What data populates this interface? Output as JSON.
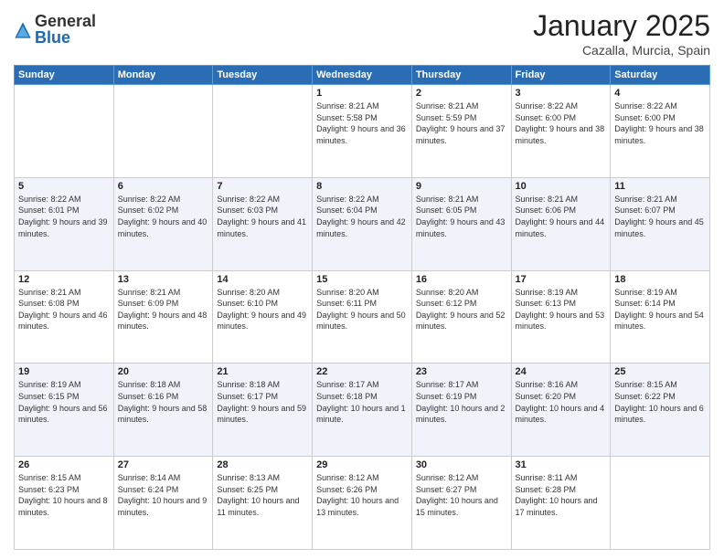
{
  "logo": {
    "general": "General",
    "blue": "Blue"
  },
  "title": {
    "month": "January 2025",
    "location": "Cazalla, Murcia, Spain"
  },
  "headers": [
    "Sunday",
    "Monday",
    "Tuesday",
    "Wednesday",
    "Thursday",
    "Friday",
    "Saturday"
  ],
  "weeks": [
    [
      {
        "day": "",
        "info": ""
      },
      {
        "day": "",
        "info": ""
      },
      {
        "day": "",
        "info": ""
      },
      {
        "day": "1",
        "info": "Sunrise: 8:21 AM\nSunset: 5:58 PM\nDaylight: 9 hours and 36 minutes."
      },
      {
        "day": "2",
        "info": "Sunrise: 8:21 AM\nSunset: 5:59 PM\nDaylight: 9 hours and 37 minutes."
      },
      {
        "day": "3",
        "info": "Sunrise: 8:22 AM\nSunset: 6:00 PM\nDaylight: 9 hours and 38 minutes."
      },
      {
        "day": "4",
        "info": "Sunrise: 8:22 AM\nSunset: 6:00 PM\nDaylight: 9 hours and 38 minutes."
      }
    ],
    [
      {
        "day": "5",
        "info": "Sunrise: 8:22 AM\nSunset: 6:01 PM\nDaylight: 9 hours and 39 minutes."
      },
      {
        "day": "6",
        "info": "Sunrise: 8:22 AM\nSunset: 6:02 PM\nDaylight: 9 hours and 40 minutes."
      },
      {
        "day": "7",
        "info": "Sunrise: 8:22 AM\nSunset: 6:03 PM\nDaylight: 9 hours and 41 minutes."
      },
      {
        "day": "8",
        "info": "Sunrise: 8:22 AM\nSunset: 6:04 PM\nDaylight: 9 hours and 42 minutes."
      },
      {
        "day": "9",
        "info": "Sunrise: 8:21 AM\nSunset: 6:05 PM\nDaylight: 9 hours and 43 minutes."
      },
      {
        "day": "10",
        "info": "Sunrise: 8:21 AM\nSunset: 6:06 PM\nDaylight: 9 hours and 44 minutes."
      },
      {
        "day": "11",
        "info": "Sunrise: 8:21 AM\nSunset: 6:07 PM\nDaylight: 9 hours and 45 minutes."
      }
    ],
    [
      {
        "day": "12",
        "info": "Sunrise: 8:21 AM\nSunset: 6:08 PM\nDaylight: 9 hours and 46 minutes."
      },
      {
        "day": "13",
        "info": "Sunrise: 8:21 AM\nSunset: 6:09 PM\nDaylight: 9 hours and 48 minutes."
      },
      {
        "day": "14",
        "info": "Sunrise: 8:20 AM\nSunset: 6:10 PM\nDaylight: 9 hours and 49 minutes."
      },
      {
        "day": "15",
        "info": "Sunrise: 8:20 AM\nSunset: 6:11 PM\nDaylight: 9 hours and 50 minutes."
      },
      {
        "day": "16",
        "info": "Sunrise: 8:20 AM\nSunset: 6:12 PM\nDaylight: 9 hours and 52 minutes."
      },
      {
        "day": "17",
        "info": "Sunrise: 8:19 AM\nSunset: 6:13 PM\nDaylight: 9 hours and 53 minutes."
      },
      {
        "day": "18",
        "info": "Sunrise: 8:19 AM\nSunset: 6:14 PM\nDaylight: 9 hours and 54 minutes."
      }
    ],
    [
      {
        "day": "19",
        "info": "Sunrise: 8:19 AM\nSunset: 6:15 PM\nDaylight: 9 hours and 56 minutes."
      },
      {
        "day": "20",
        "info": "Sunrise: 8:18 AM\nSunset: 6:16 PM\nDaylight: 9 hours and 58 minutes."
      },
      {
        "day": "21",
        "info": "Sunrise: 8:18 AM\nSunset: 6:17 PM\nDaylight: 9 hours and 59 minutes."
      },
      {
        "day": "22",
        "info": "Sunrise: 8:17 AM\nSunset: 6:18 PM\nDaylight: 10 hours and 1 minute."
      },
      {
        "day": "23",
        "info": "Sunrise: 8:17 AM\nSunset: 6:19 PM\nDaylight: 10 hours and 2 minutes."
      },
      {
        "day": "24",
        "info": "Sunrise: 8:16 AM\nSunset: 6:20 PM\nDaylight: 10 hours and 4 minutes."
      },
      {
        "day": "25",
        "info": "Sunrise: 8:15 AM\nSunset: 6:22 PM\nDaylight: 10 hours and 6 minutes."
      }
    ],
    [
      {
        "day": "26",
        "info": "Sunrise: 8:15 AM\nSunset: 6:23 PM\nDaylight: 10 hours and 8 minutes."
      },
      {
        "day": "27",
        "info": "Sunrise: 8:14 AM\nSunset: 6:24 PM\nDaylight: 10 hours and 9 minutes."
      },
      {
        "day": "28",
        "info": "Sunrise: 8:13 AM\nSunset: 6:25 PM\nDaylight: 10 hours and 11 minutes."
      },
      {
        "day": "29",
        "info": "Sunrise: 8:12 AM\nSunset: 6:26 PM\nDaylight: 10 hours and 13 minutes."
      },
      {
        "day": "30",
        "info": "Sunrise: 8:12 AM\nSunset: 6:27 PM\nDaylight: 10 hours and 15 minutes."
      },
      {
        "day": "31",
        "info": "Sunrise: 8:11 AM\nSunset: 6:28 PM\nDaylight: 10 hours and 17 minutes."
      },
      {
        "day": "",
        "info": ""
      }
    ]
  ]
}
